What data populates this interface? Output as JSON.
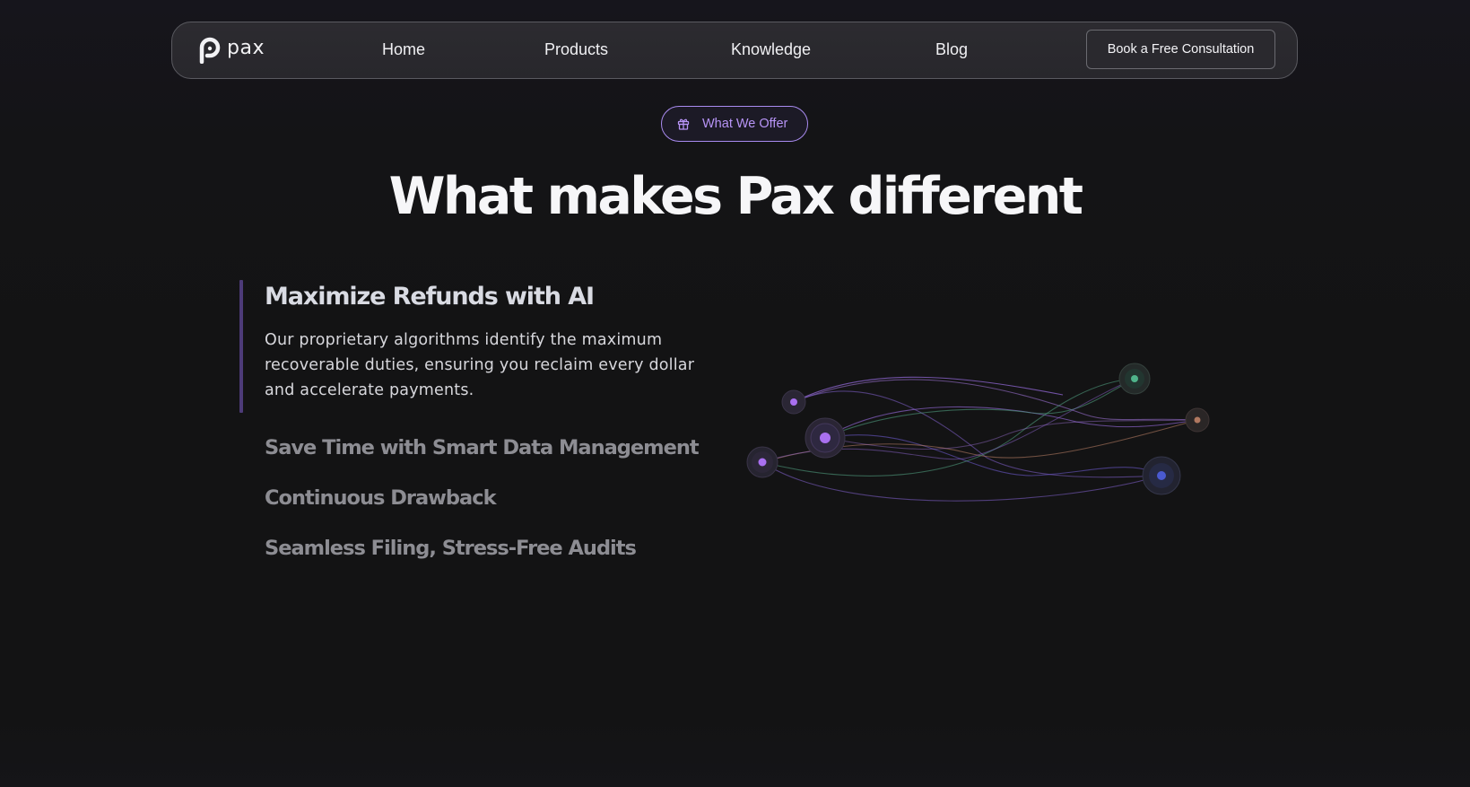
{
  "nav": {
    "logo_text": "pax",
    "links": [
      {
        "label": "Home"
      },
      {
        "label": "Products"
      },
      {
        "label": "Knowledge"
      },
      {
        "label": "Blog"
      }
    ],
    "cta_label": "Book a Free Consultation"
  },
  "badge": {
    "label": "What We Offer",
    "icon": "gift-icon"
  },
  "section_title": "What makes Pax different",
  "features": {
    "active": {
      "title": "Maximize Refunds with AI",
      "description": "Our proprietary algorithms identify the maximum recoverable duties, ensuring you reclaim every dollar and accelerate payments."
    },
    "items": [
      {
        "title": "Save Time with Smart Data Management"
      },
      {
        "title": "Continuous Drawback"
      },
      {
        "title": "Seamless Filing, Stress-Free Audits"
      }
    ]
  },
  "colors": {
    "background": "#131314",
    "accent": "#b794f6",
    "node_purple": "#a970f0",
    "node_green": "#4fb38a",
    "node_orange": "#b07860",
    "node_blue": "#4a5ad0"
  }
}
